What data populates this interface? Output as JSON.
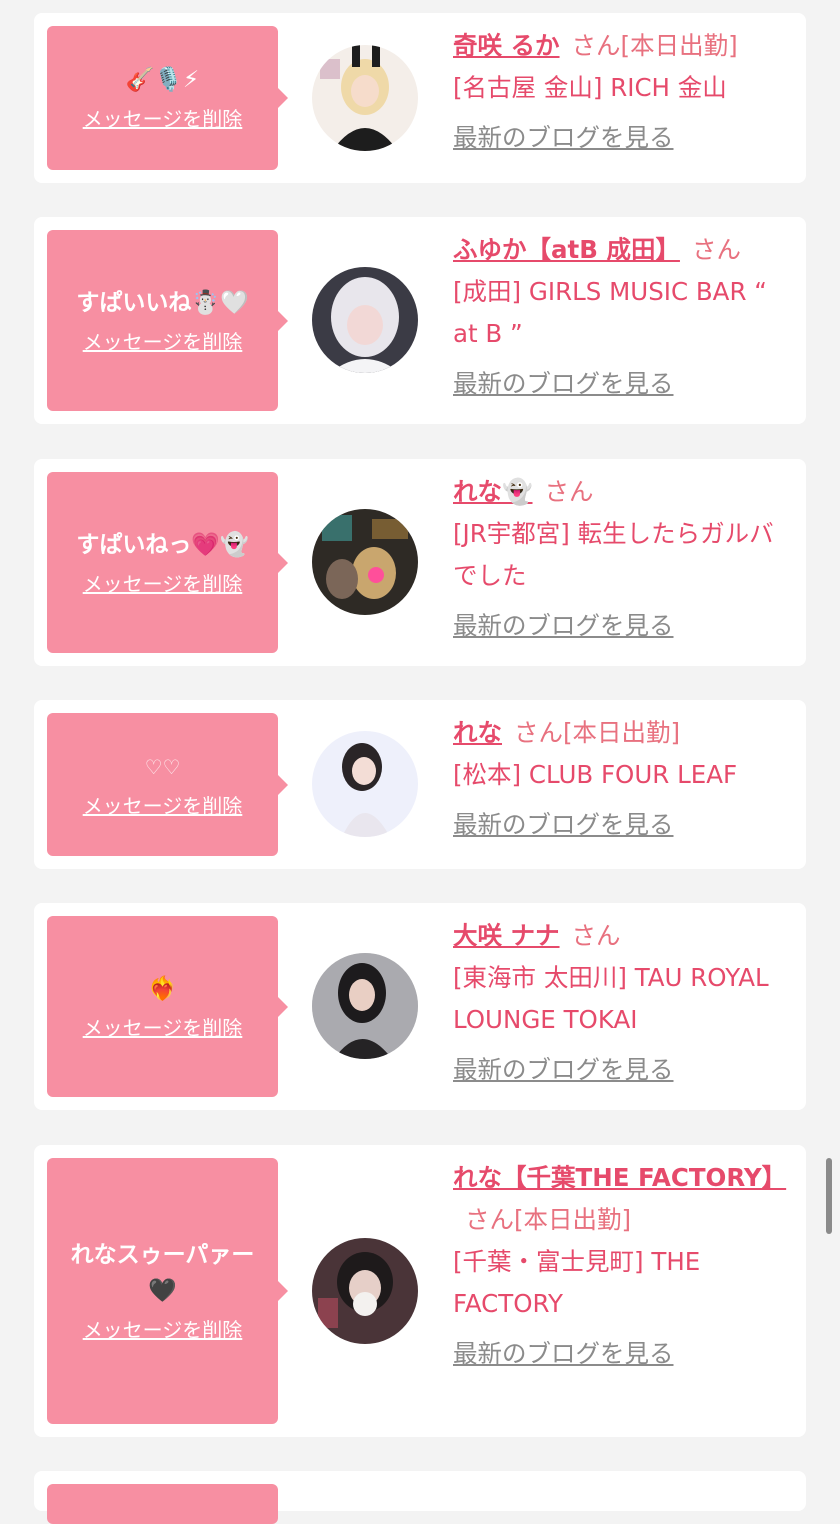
{
  "cards": [
    {
      "message": "🎸🎙️⚡",
      "delete_label": "メッセージを削除",
      "name": "奇咲 るか",
      "suffix": "さん[本日出勤]",
      "shop": "[名古屋 金山] RICH 金山",
      "blog_label": "最新のブログを見る"
    },
    {
      "message": "すぱいいね☃️🤍",
      "delete_label": "メッセージを削除",
      "name": "ふゆか【atB 成田】",
      "suffix": "さん",
      "shop": "[成田] GIRLS MUSIC BAR “ at B ”",
      "blog_label": "最新のブログを見る"
    },
    {
      "message": "すぱいねっ💗👻",
      "delete_label": "メッセージを削除",
      "name": "れな👻",
      "suffix": "さん",
      "shop": "[JR宇都宮] 転生したらガルバでした",
      "blog_label": "最新のブログを見る"
    },
    {
      "message": "♡♡",
      "delete_label": "メッセージを削除",
      "name": "れな",
      "suffix": "さん[本日出勤]",
      "shop": "[松本] CLUB FOUR LEAF",
      "blog_label": "最新のブログを見る"
    },
    {
      "message": "❤️‍🔥",
      "delete_label": "メッセージを削除",
      "name": "大咲 ナナ",
      "suffix": "さん",
      "shop": "[東海市 太田川] TAU ROYAL LOUNGE TOKAI",
      "blog_label": "最新のブログを見る"
    },
    {
      "message": "れなスゥーパァー🖤",
      "delete_label": "メッセージを削除",
      "name": "れな【千葉THE FACTORY】",
      "suffix": "さん[本日出勤]",
      "shop": "[千葉・富士見町] THE FACTORY",
      "blog_label": "最新のブログを見る"
    }
  ]
}
